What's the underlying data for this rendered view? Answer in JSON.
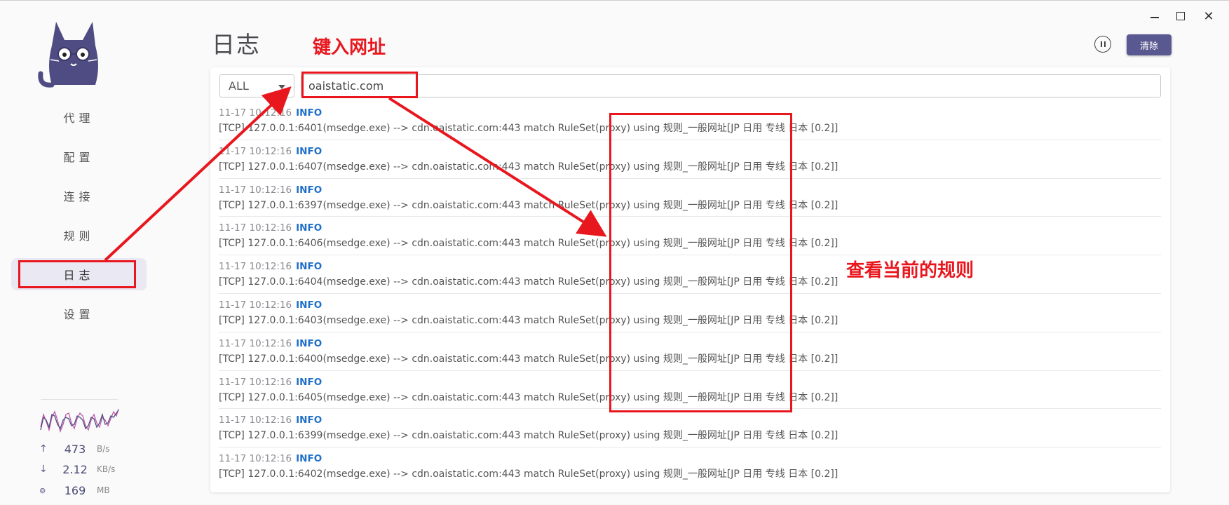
{
  "window": {
    "controls": {
      "minimize": "minimize-icon",
      "maximize": "maximize-icon",
      "close": "close-icon"
    }
  },
  "sidebar": {
    "items": [
      {
        "label": "代理",
        "active": false
      },
      {
        "label": "配置",
        "active": false
      },
      {
        "label": "连接",
        "active": false
      },
      {
        "label": "规则",
        "active": false
      },
      {
        "label": "日志",
        "active": true
      },
      {
        "label": "设置",
        "active": false
      }
    ],
    "traffic": {
      "upload": {
        "value": "473",
        "unit": "B/s",
        "icon": "arrow-up-icon"
      },
      "download": {
        "value": "2.12",
        "unit": "KB/s",
        "icon": "arrow-down-icon"
      },
      "memory": {
        "value": "169",
        "unit": "MB",
        "icon": "memory-icon"
      }
    }
  },
  "header": {
    "title": "日志",
    "clear_label": "清除"
  },
  "filter": {
    "level": "ALL",
    "search_value": "oaistatic.com"
  },
  "logs": [
    {
      "time": "11-17 10:12:16",
      "level": "INFO",
      "message": "[TCP] 127.0.0.1:6401(msedge.exe) --> cdn.oaistatic.com:443 match RuleSet(proxy) using 规则_一般网址[JP 日用 专线 日本 [0.2]]"
    },
    {
      "time": "11-17 10:12:16",
      "level": "INFO",
      "message": "[TCP] 127.0.0.1:6407(msedge.exe) --> cdn.oaistatic.com:443 match RuleSet(proxy) using 规则_一般网址[JP 日用 专线 日本 [0.2]]"
    },
    {
      "time": "11-17 10:12:16",
      "level": "INFO",
      "message": "[TCP] 127.0.0.1:6397(msedge.exe) --> cdn.oaistatic.com:443 match RuleSet(proxy) using 规则_一般网址[JP 日用 专线 日本 [0.2]]"
    },
    {
      "time": "11-17 10:12:16",
      "level": "INFO",
      "message": "[TCP] 127.0.0.1:6406(msedge.exe) --> cdn.oaistatic.com:443 match RuleSet(proxy) using 规则_一般网址[JP 日用 专线 日本 [0.2]]"
    },
    {
      "time": "11-17 10:12:16",
      "level": "INFO",
      "message": "[TCP] 127.0.0.1:6404(msedge.exe) --> cdn.oaistatic.com:443 match RuleSet(proxy) using 规则_一般网址[JP 日用 专线 日本 [0.2]]"
    },
    {
      "time": "11-17 10:12:16",
      "level": "INFO",
      "message": "[TCP] 127.0.0.1:6403(msedge.exe) --> cdn.oaistatic.com:443 match RuleSet(proxy) using 规则_一般网址[JP 日用 专线 日本 [0.2]]"
    },
    {
      "time": "11-17 10:12:16",
      "level": "INFO",
      "message": "[TCP] 127.0.0.1:6400(msedge.exe) --> cdn.oaistatic.com:443 match RuleSet(proxy) using 规则_一般网址[JP 日用 专线 日本 [0.2]]"
    },
    {
      "time": "11-17 10:12:16",
      "level": "INFO",
      "message": "[TCP] 127.0.0.1:6405(msedge.exe) --> cdn.oaistatic.com:443 match RuleSet(proxy) using 规则_一般网址[JP 日用 专线 日本 [0.2]]"
    },
    {
      "time": "11-17 10:12:16",
      "level": "INFO",
      "message": "[TCP] 127.0.0.1:6399(msedge.exe) --> cdn.oaistatic.com:443 match RuleSet(proxy) using 规则_一般网址[JP 日用 专线 日本 [0.2]]"
    },
    {
      "time": "11-17 10:12:16",
      "level": "INFO",
      "message": "[TCP] 127.0.0.1:6402(msedge.exe) --> cdn.oaistatic.com:443 match RuleSet(proxy) using 规则_一般网址[JP 日用 专线 日本 [0.2]]"
    }
  ],
  "annotations": {
    "type_url": "键入网址",
    "view_rule": "查看当前的规则",
    "color": "#e8171e"
  },
  "colors": {
    "accent": "#5a5890",
    "info": "#1f6fc9"
  }
}
